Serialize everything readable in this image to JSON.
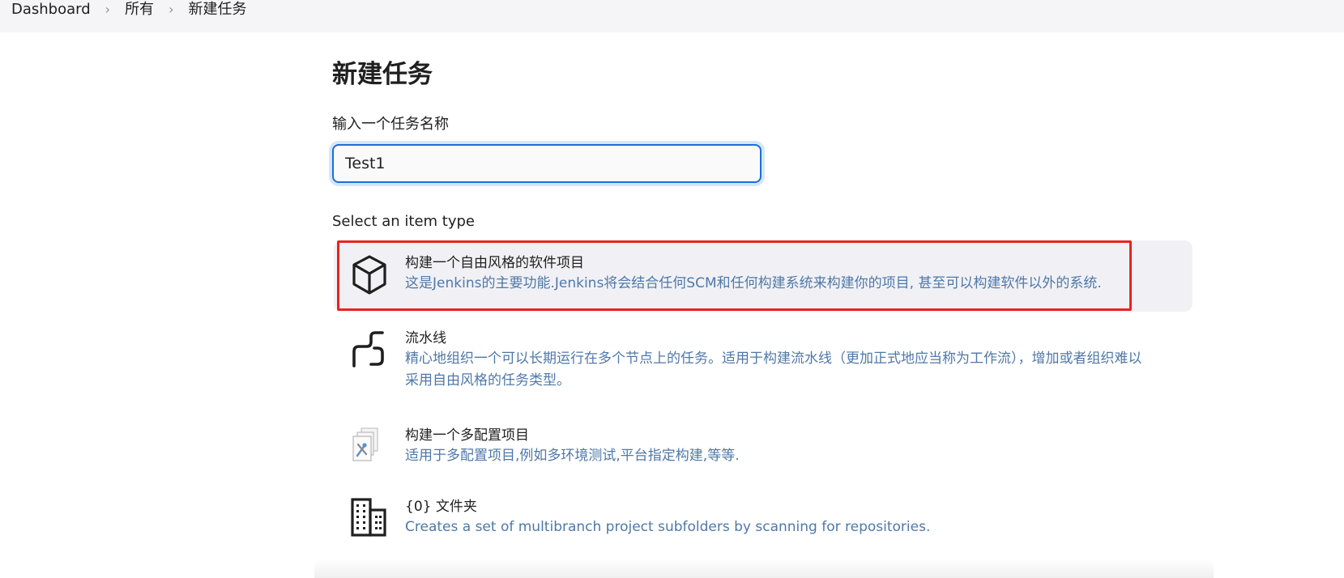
{
  "breadcrumb": {
    "items": [
      {
        "label": "Dashboard"
      },
      {
        "label": "所有"
      },
      {
        "label": "新建任务"
      }
    ],
    "separator": ">"
  },
  "page": {
    "title": "新建任务",
    "name_label": "输入一个任务名称",
    "name_value": "Test1",
    "type_label": "Select an item type"
  },
  "item_types": [
    {
      "icon": "package-icon",
      "title": "构建一个自由风格的软件项目",
      "description": "这是Jenkins的主要功能.Jenkins将会结合任何SCM和任何构建系统来构建你的项目, 甚至可以构建软件以外的系统.",
      "selected": true
    },
    {
      "icon": "pipeline-icon",
      "title": "流水线",
      "description_line1": "精心地组织一个可以长期运行在多个节点上的任务。适用于构建流水线（更加正式地应当称为工作流），增加或者组织难以",
      "description_line2": "采用自由风格的任务类型。",
      "selected": false
    },
    {
      "icon": "multi-config-icon",
      "title": "构建一个多配置项目",
      "description": "适用于多配置项目,例如多环境测试,平台指定构建,等等.",
      "selected": false
    },
    {
      "icon": "building-icon",
      "title": "{0} 文件夹",
      "description": "Creates a set of multibranch project subfolders by scanning for repositories.",
      "selected": false
    }
  ],
  "colors": {
    "accent": "#1a6fd8",
    "description": "#4f78a8",
    "highlight": "#e8241d",
    "selected_bg": "#f1f1f5"
  }
}
